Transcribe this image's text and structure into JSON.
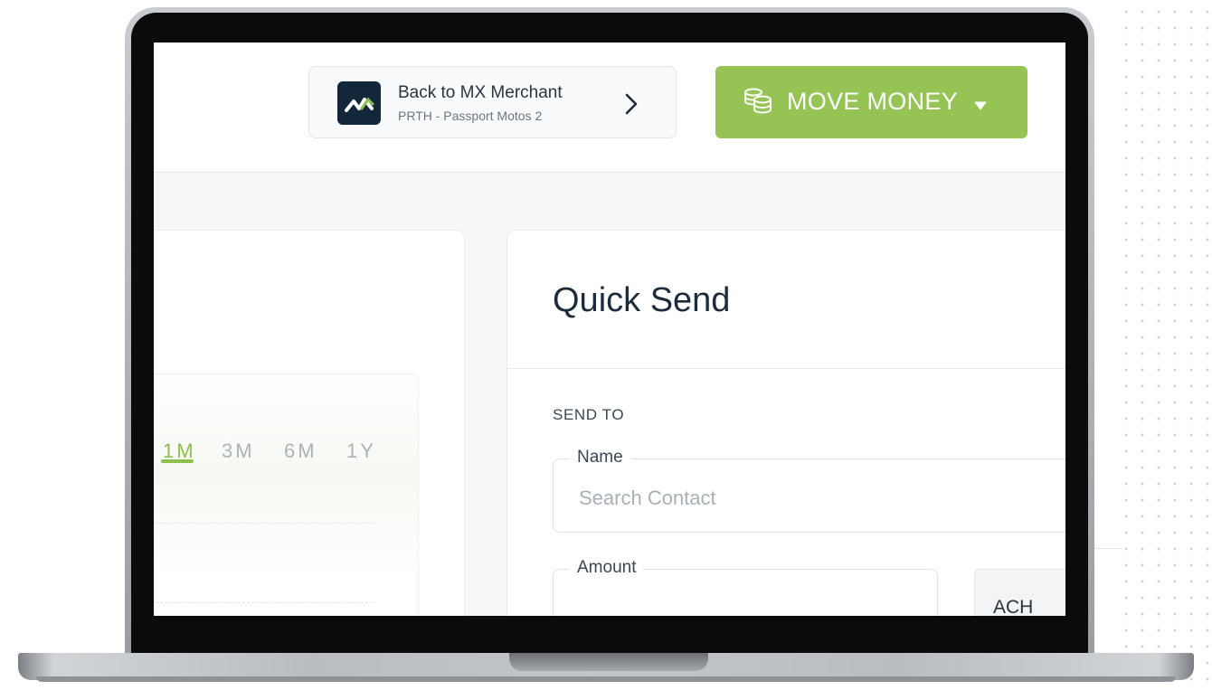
{
  "header": {
    "back_button": {
      "title": "Back to MX Merchant",
      "subtitle": "PRTH - Passport Motos 2"
    },
    "move_money": {
      "label": "MOVE MONEY"
    }
  },
  "chart_panel": {
    "ranges": [
      {
        "label": "1M",
        "active": true
      },
      {
        "label": "3M",
        "active": false
      },
      {
        "label": "6M",
        "active": false
      },
      {
        "label": "1Y",
        "active": false
      }
    ]
  },
  "quick_send": {
    "title": "Quick Send",
    "section_label": "SEND TO",
    "name_field": {
      "label": "Name",
      "placeholder": "Search Contact",
      "value": ""
    },
    "amount_field": {
      "label": "Amount",
      "value": ""
    },
    "method": {
      "label": "ACH"
    }
  },
  "colors": {
    "accent_green": "#95c454",
    "navy_text": "#1d2c3c",
    "logo_bg": "#13273a"
  },
  "icons": [
    "mx-logo-icon",
    "chevron-right-icon",
    "coins-stack-icon",
    "caret-down-icon"
  ]
}
